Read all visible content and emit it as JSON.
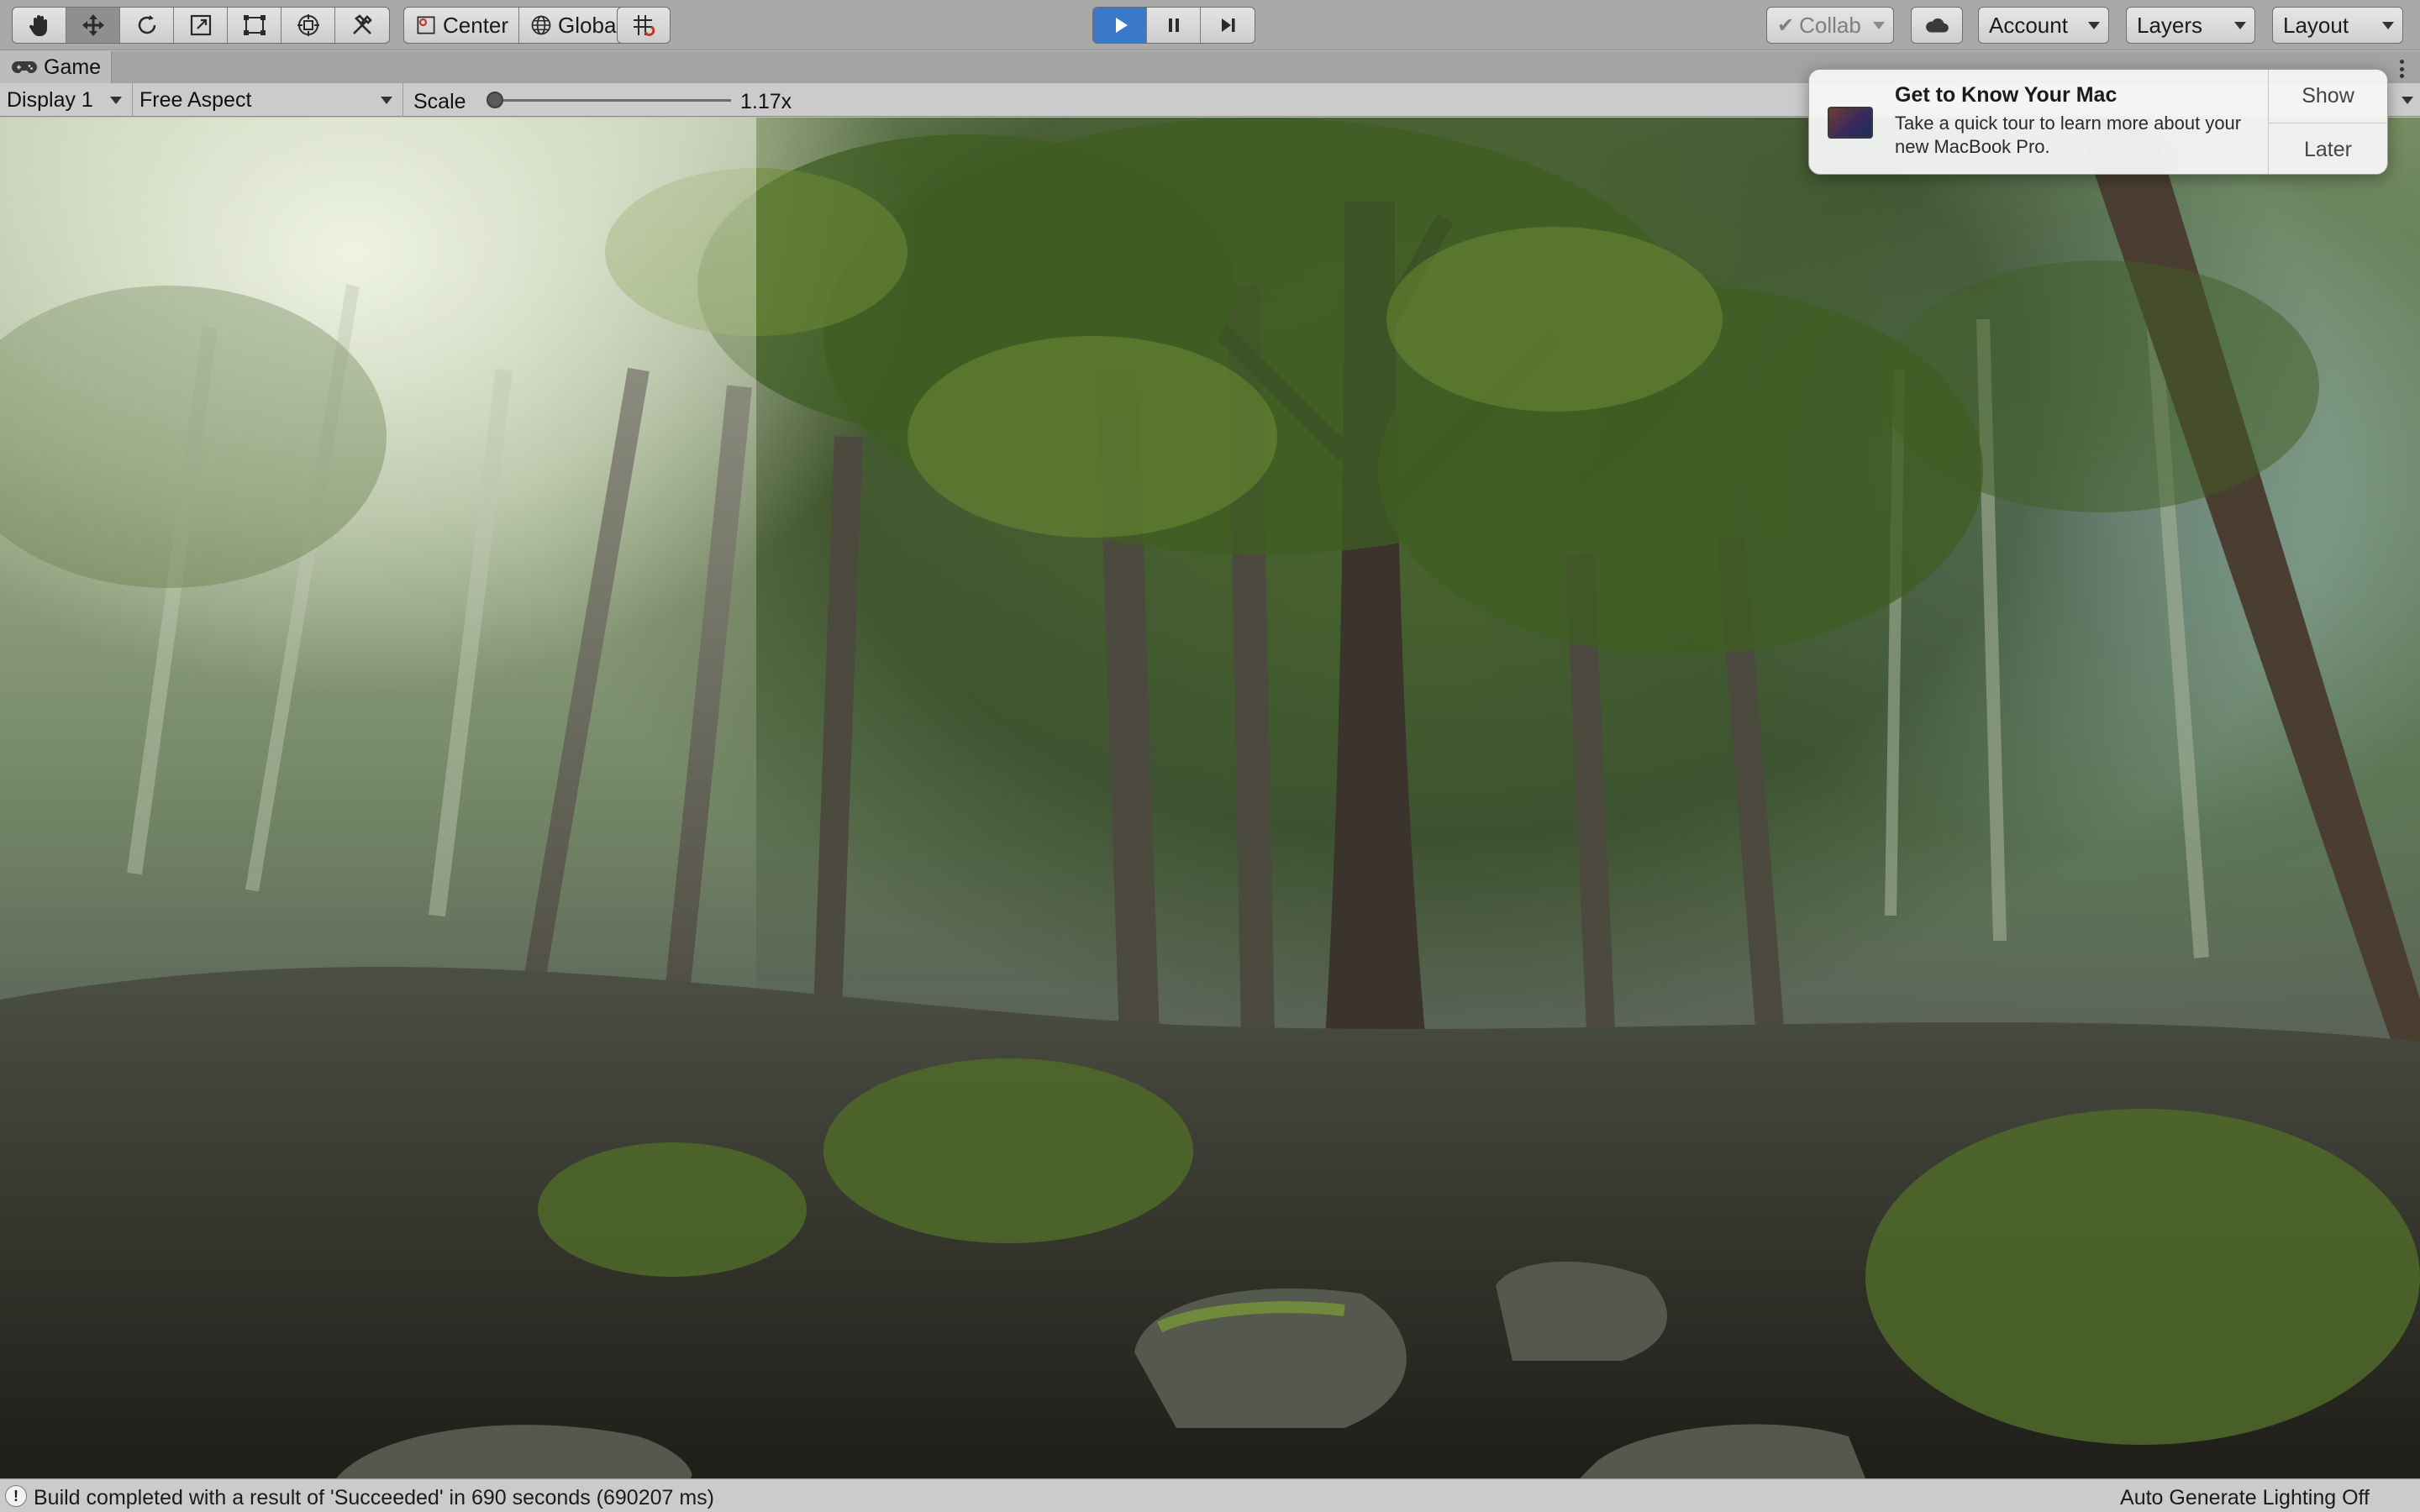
{
  "toolbar": {
    "tools": [
      {
        "name": "hand-tool",
        "icon": "hand-icon"
      },
      {
        "name": "move-tool",
        "icon": "move-icon"
      },
      {
        "name": "rotate-tool",
        "icon": "rotate-icon"
      },
      {
        "name": "scale-tool",
        "icon": "scale-icon"
      },
      {
        "name": "rect-tool",
        "icon": "rect-icon"
      },
      {
        "name": "transform-tool",
        "icon": "transform-icon"
      },
      {
        "name": "custom-tool",
        "icon": "tools-icon"
      }
    ],
    "pivot_mode_label": "Center",
    "pivot_rotation_label": "Global",
    "snap_icon": "grid-snap-icon",
    "play_icon": "play-icon",
    "pause_icon": "pause-icon",
    "step_icon": "step-icon",
    "collab_label": "Collab",
    "cloud_icon": "cloud-icon",
    "account_label": "Account",
    "layers_label": "Layers",
    "layout_label": "Layout"
  },
  "game_tab": {
    "label": "Game",
    "icon": "gamepad-icon"
  },
  "game_controls": {
    "display_label": "Display 1",
    "aspect_label": "Free Aspect",
    "scale_label": "Scale",
    "scale_value": "1.17x",
    "scale_fraction": 0.03
  },
  "notification": {
    "title": "Get to Know Your Mac",
    "body": "Take a quick tour to learn more about your new MacBook Pro.",
    "show_label": "Show",
    "later_label": "Later"
  },
  "status": {
    "icon_glyph": "!",
    "message": "Build completed with a result of 'Succeeded' in 690 seconds (690207 ms)",
    "lighting": "Auto Generate Lighting Off"
  },
  "colors": {
    "toolbar_bg": "#a9a9a9",
    "play_active": "#3a78c9",
    "panel_bg": "#cbcbcb"
  }
}
